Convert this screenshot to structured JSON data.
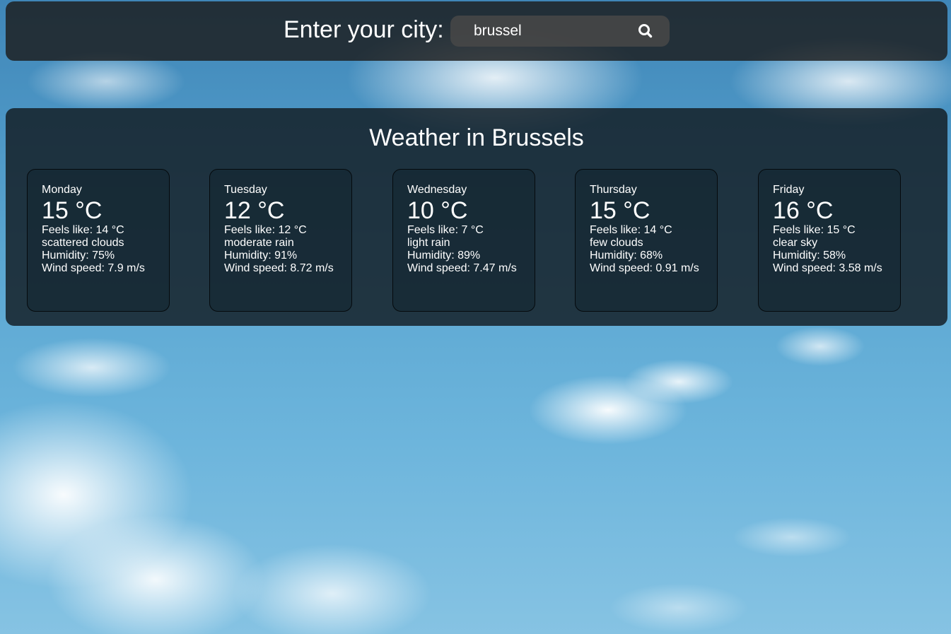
{
  "search": {
    "label": "Enter your city:",
    "value": "brussel",
    "button_icon": "search-icon"
  },
  "weather": {
    "title": "Weather in Brussels",
    "days": [
      {
        "day": "Monday",
        "temp": "15 °C",
        "feels_like": "Feels like: 14 °C",
        "description": "scattered clouds",
        "humidity": "Humidity: 75%",
        "wind": "Wind speed: 7.9 m/s"
      },
      {
        "day": "Tuesday",
        "temp": "12 °C",
        "feels_like": "Feels like: 12 °C",
        "description": "moderate rain",
        "humidity": "Humidity: 91%",
        "wind": "Wind speed: 8.72 m/s"
      },
      {
        "day": "Wednesday",
        "temp": "10 °C",
        "feels_like": "Feels like: 7 °C",
        "description": "light rain",
        "humidity": "Humidity: 89%",
        "wind": "Wind speed: 7.47 m/s"
      },
      {
        "day": "Thursday",
        "temp": "15 °C",
        "feels_like": "Feels like: 14 °C",
        "description": "few clouds",
        "humidity": "Humidity: 68%",
        "wind": "Wind speed: 0.91 m/s"
      },
      {
        "day": "Friday",
        "temp": "16 °C",
        "feels_like": "Feels like: 15 °C",
        "description": "clear sky",
        "humidity": "Humidity: 58%",
        "wind": "Wind speed: 3.58 m/s"
      }
    ]
  },
  "colors": {
    "text": "#ffffff",
    "panel": "#171d21",
    "sky": "#6db5dc"
  }
}
